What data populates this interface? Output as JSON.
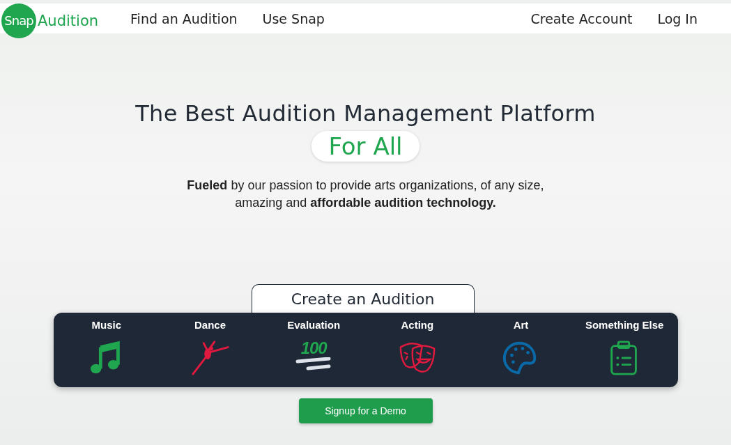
{
  "nav": {
    "logo": {
      "mark": "Snap",
      "word": "Audition"
    },
    "links": [
      "Find an Audition",
      "Use Snap"
    ],
    "account_links": [
      "Create Account",
      "Log In"
    ]
  },
  "hero": {
    "title": "The Best Audition Management Platform",
    "highlight": "For All",
    "tagline": "**Fueled** by our passion to provide arts organizations, of any size, amazing and **affordable audition technology.**"
  },
  "create": {
    "tab": "Create an Audition",
    "categories": [
      {
        "label": "Music",
        "kind": "music",
        "color": "#1fa64f"
      },
      {
        "label": "Dance",
        "kind": "dance",
        "color": "#e0193f"
      },
      {
        "label": "Evaluation",
        "kind": "score",
        "color": "#1fa64f",
        "icon_text": "100"
      },
      {
        "label": "Acting",
        "kind": "masks",
        "color": "#e0193f"
      },
      {
        "label": "Art",
        "kind": "palette",
        "color": "#0a6aa8"
      },
      {
        "label": "Something Else",
        "kind": "clipboard",
        "color": "#1fa64f"
      }
    ]
  },
  "demo_button": "Signup for a Demo"
}
